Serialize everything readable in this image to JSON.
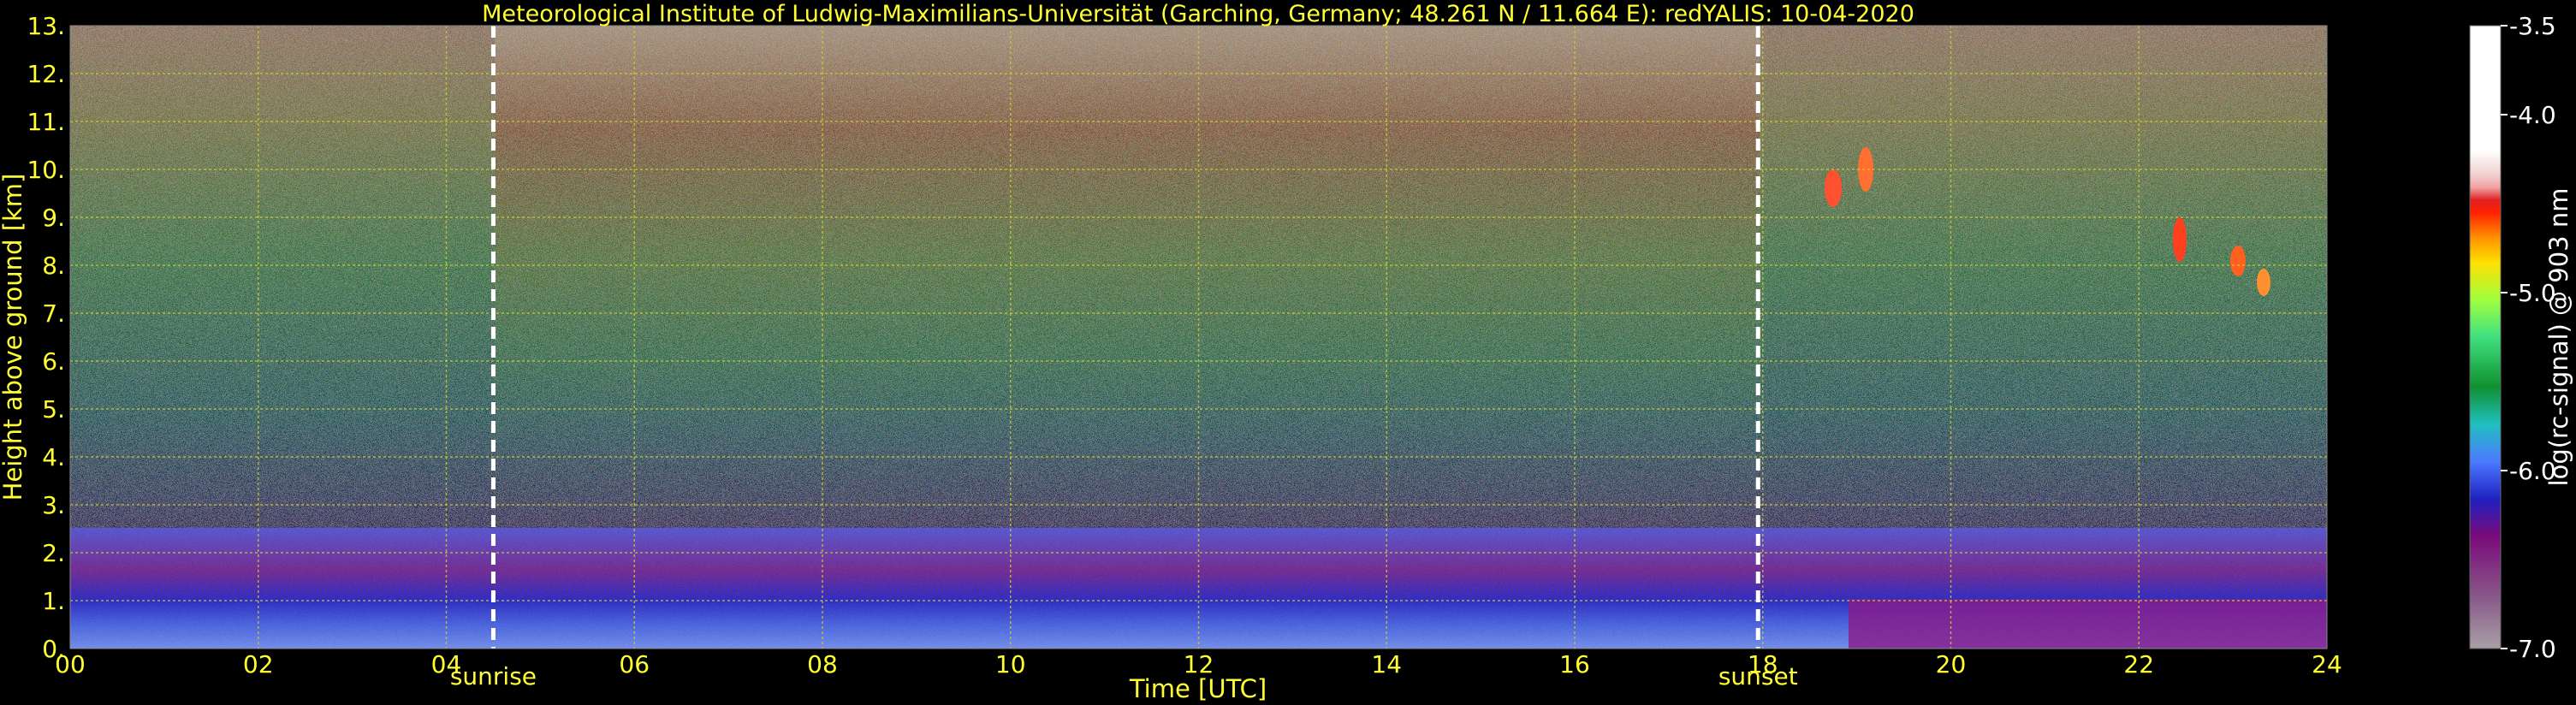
{
  "chart_data": {
    "type": "heatmap",
    "title": "Meteorological Institute of Ludwig-Maximilians-Universität (Garching, Germany; 48.261 N / 11.664 E):    redYALIS: 10-04-2020",
    "xlabel": "Time [UTC]",
    "ylabel": "Height above ground [km]",
    "xlim": [
      0,
      24
    ],
    "ylim": [
      0,
      13
    ],
    "x_ticks": [
      0,
      2,
      4,
      6,
      8,
      10,
      12,
      14,
      16,
      18,
      20,
      22,
      24
    ],
    "x_tick_labels": [
      "00",
      "02",
      "04",
      "06",
      "08",
      "10",
      "12",
      "14",
      "16",
      "18",
      "20",
      "22",
      "24"
    ],
    "y_ticks": [
      0,
      1,
      2,
      3,
      4,
      5,
      6,
      7,
      8,
      9,
      10,
      11,
      12,
      13
    ],
    "y_tick_labels": [
      "0.",
      "1.",
      "2.",
      "3.",
      "4.",
      "5.",
      "6.",
      "7.",
      "8.",
      "9.",
      "10.",
      "11.",
      "12.",
      "13."
    ],
    "grid": true,
    "markers": [
      {
        "x": 4.5,
        "label": "sunrise"
      },
      {
        "x": 17.95,
        "label": "sunset"
      }
    ],
    "colorbar": {
      "label": "log(rc-signal) @ 903 nm",
      "range": [
        -7.0,
        -3.5
      ],
      "ticks": [
        -3.5,
        -4.0,
        -5.0,
        -6.0,
        -7.0
      ],
      "tick_labels": [
        "-3.5",
        "-4.0",
        "-5.0",
        "-6.0",
        "-7.0"
      ]
    }
  },
  "colors": {
    "background": "#000000",
    "text_yellow": "#ffff33",
    "text_white": "#ffffff",
    "grid": "#cccc33",
    "marker_line": "#ffffff"
  }
}
